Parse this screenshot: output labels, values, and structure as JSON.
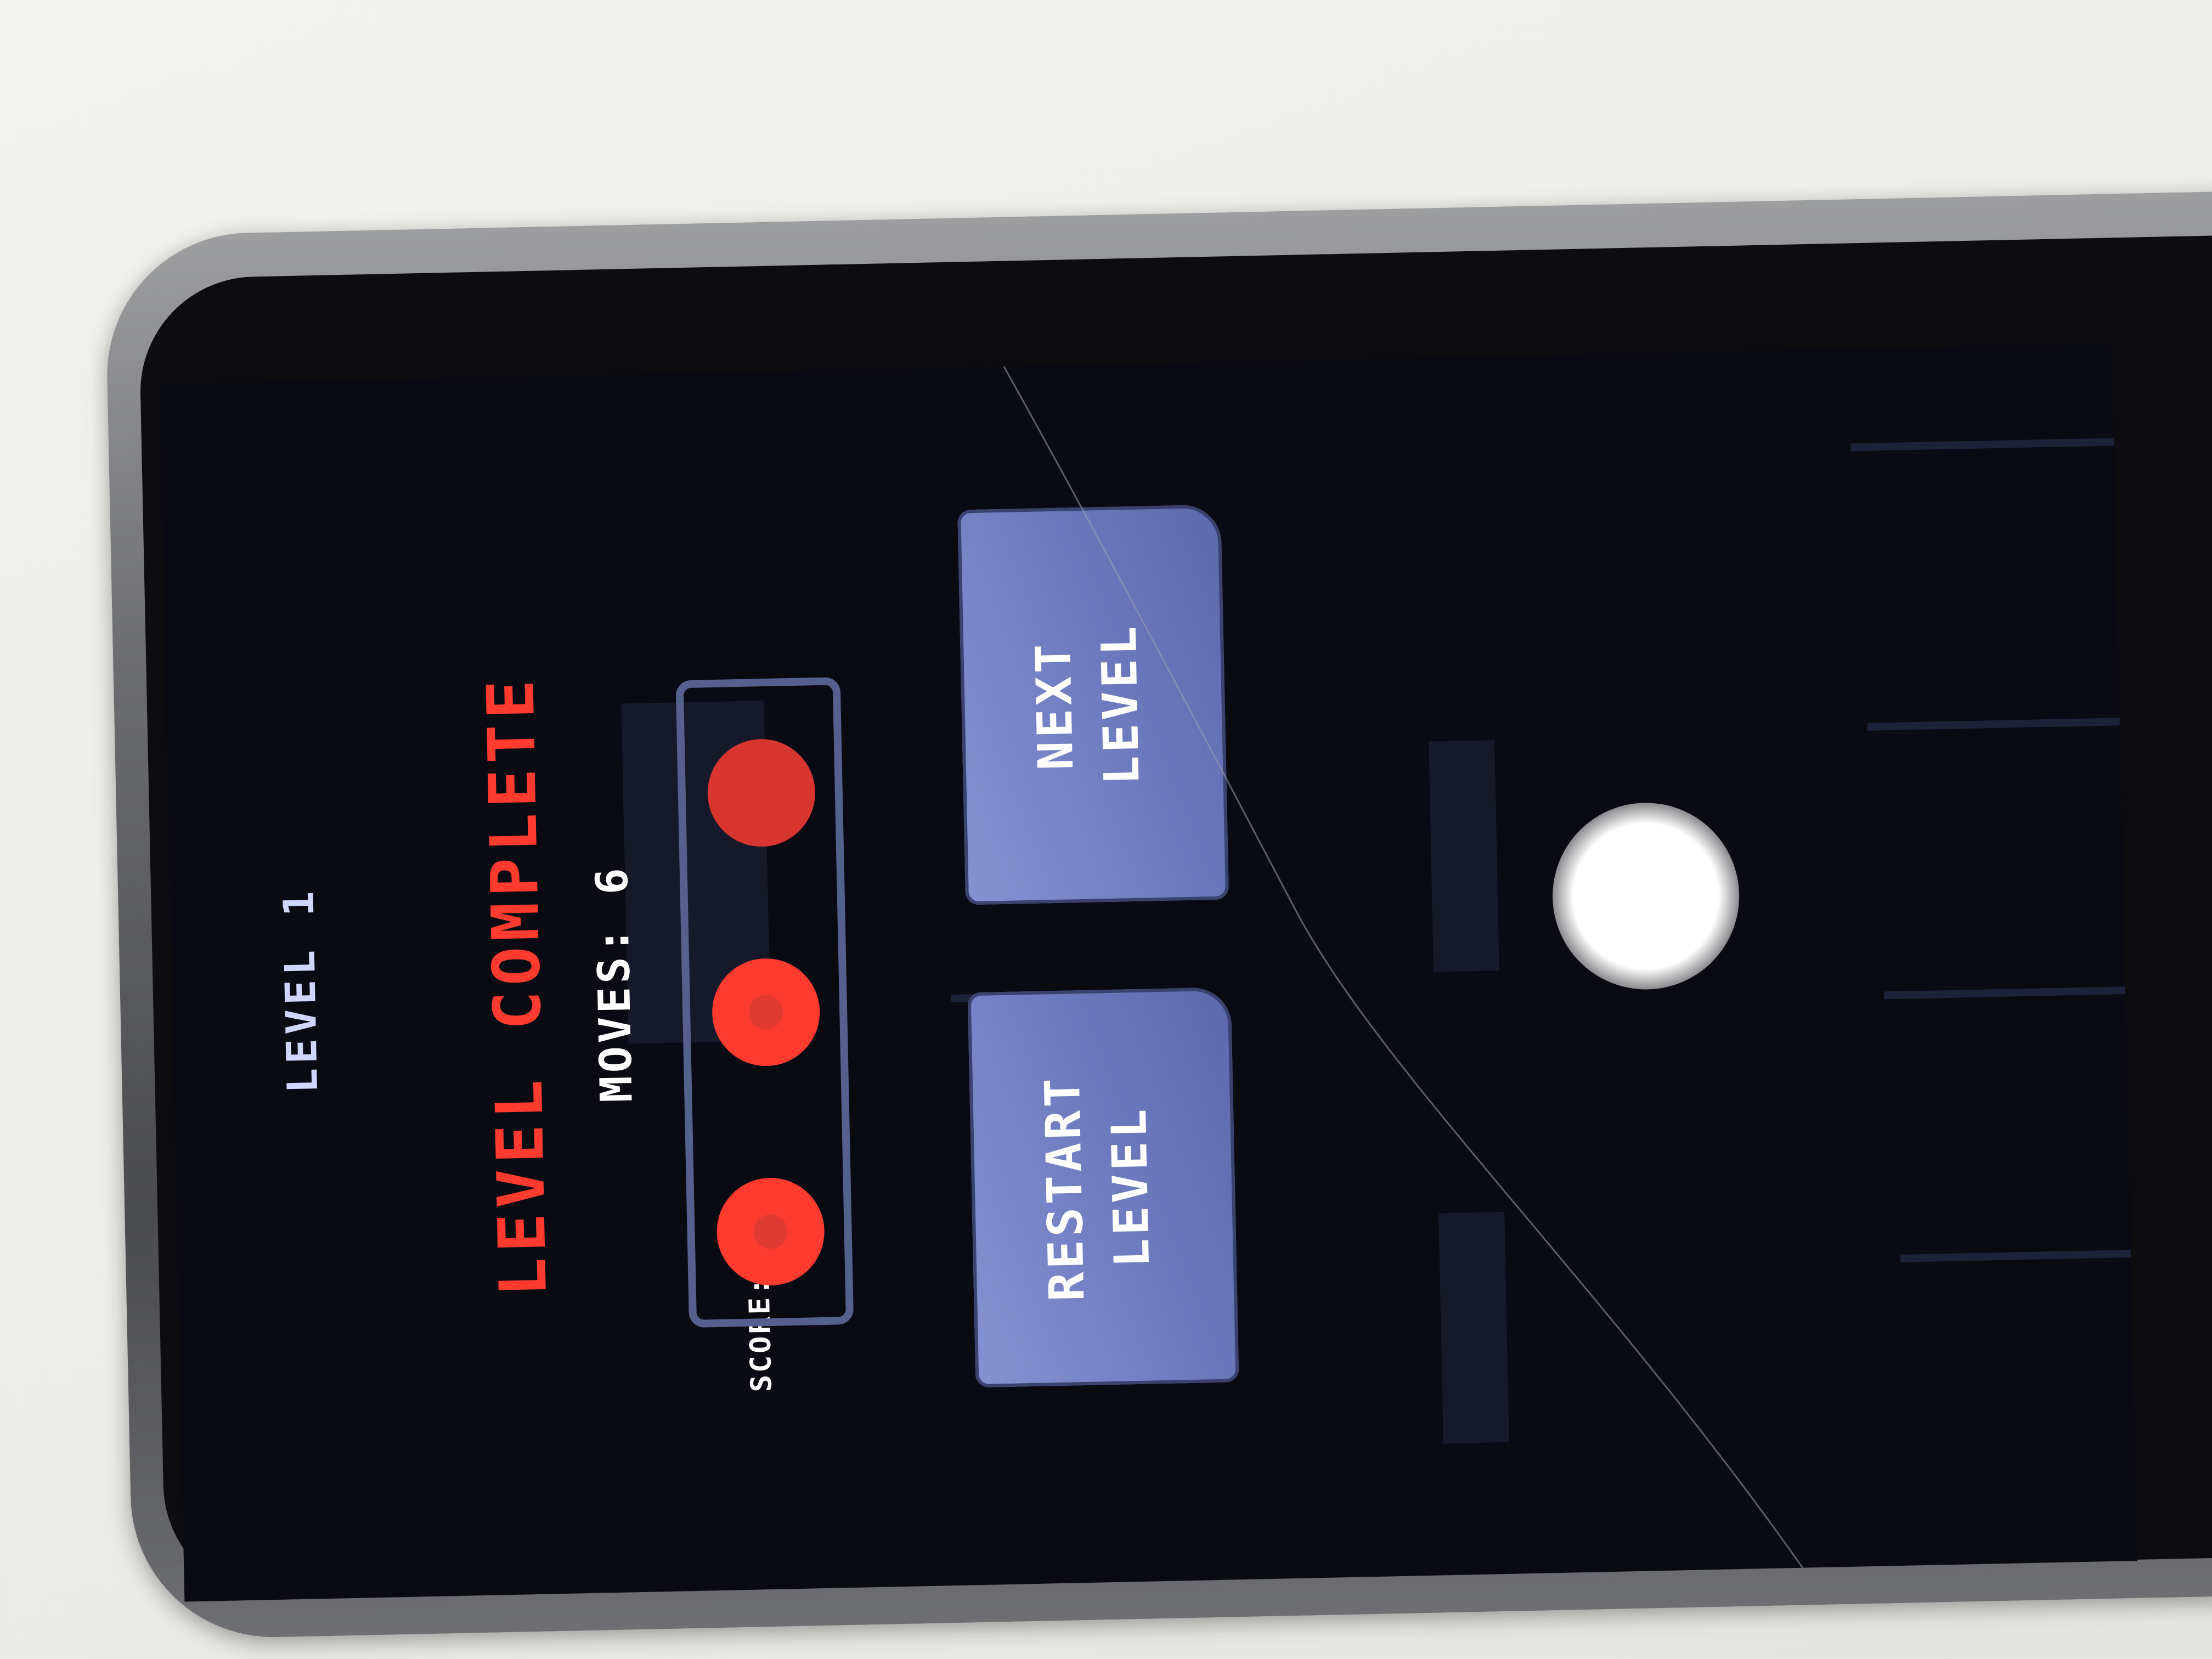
{
  "game": {
    "level_label": "LEVEL 1",
    "title_word1": "LEVEL",
    "title_word2": "COMPLETE",
    "moves_label": "MOVES: 6",
    "score_label": "SCORE:",
    "stars_earned": 3,
    "stars_total": 3,
    "buttons": {
      "restart_line1": "RESTART",
      "restart_line2": "LEVEL",
      "next_line1": "NEXT",
      "next_line2": "LEVEL"
    }
  },
  "colors": {
    "title_red": "#ff3a2e",
    "button_blue": "#7480c6",
    "score_frame": "#55608e",
    "screen_bg": "#0a0a12"
  }
}
